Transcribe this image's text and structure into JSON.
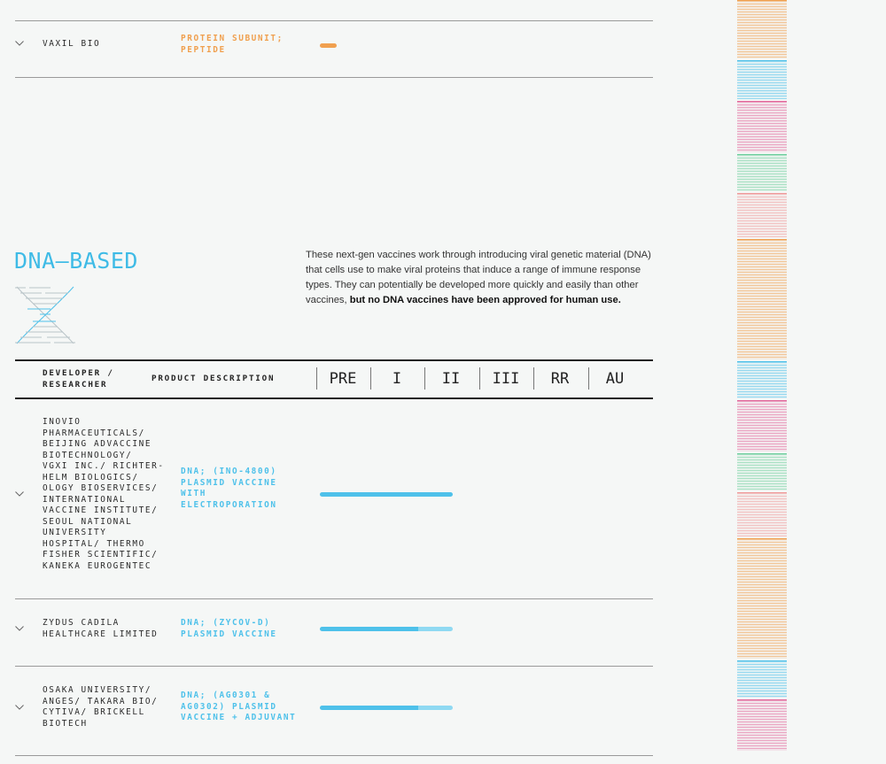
{
  "colors": {
    "orange": "#f0a04f",
    "blue": "#4ec1ea",
    "blue_light": "#8fd9f2",
    "pink": "#e2669a",
    "green": "#6fcf9f",
    "salmon": "#ef9a9a",
    "rule": "#9a9a9a"
  },
  "top_row": {
    "developer": "VAXIL BIO",
    "description": "PROTEIN SUBUNIT;\nPEPTIDE",
    "progress": 0.12
  },
  "section": {
    "title": "DNA–BASED",
    "intro_text": "These next-gen vaccines work through introducing viral genetic material (DNA) that cells use to make viral proteins that induce a range of immune response types. They can potentially be developed more quickly and easily than other vaccines, ",
    "intro_bold": "but no DNA vaccines have been approved for human use.",
    "icon": "dna-helix-icon"
  },
  "table_header": {
    "developer_label": "DEVELOPER /\nRESEARCHER",
    "product_label": "PRODUCT DESCRIPTION",
    "phases": [
      "PRE",
      "I",
      "II",
      "III",
      "RR",
      "AU"
    ]
  },
  "rows": [
    {
      "developer": "INOVIO\nPHARMACEUTICALS/\nBEIJING ADVACCINE\nBIOTECHNOLOGY/\nVGXI INC./ RICHTER-\nHELM BIOLOGICS/\nOLOGY BIOSERVICES/\nINTERNATIONAL\nVACCINE INSTITUTE/\nSEOUL NATIONAL\nUNIVERSITY\nHOSPITAL/ THERMO\nFISHER SCIENTIFIC/\nKANEKA EUROGENTEC",
      "description": "DNA; (INO-4800)\nPLASMID VACCINE\nWITH\nELECTROPORATION",
      "stage_solid": 0.5,
      "stage_light": 0.0
    },
    {
      "developer": "ZYDUS CADILA\nHEALTHCARE LIMITED",
      "description": "DNA; (ZYCOV-D)\nPLASMID VACCINE",
      "stage_solid": 0.37,
      "stage_light": 0.13
    },
    {
      "developer": "OSAKA UNIVERSITY/\nANGES/ TAKARA BIO/\nCYTIVA/ BRICKELL\nBIOTECH",
      "description": "DNA; (AG0301 &\nAG0302) PLASMID\nVACCINE + ADJUVANT",
      "stage_solid": 0.37,
      "stage_light": 0.13
    }
  ],
  "sidebar_blocks": [
    {
      "color": "orange"
    },
    {
      "color": "blue"
    },
    {
      "color": "pink"
    },
    {
      "color": "green"
    },
    {
      "color": "salmon"
    },
    {
      "color": "orange"
    },
    {
      "color": "blue"
    },
    {
      "color": "pink"
    },
    {
      "color": "green"
    },
    {
      "color": "salmon"
    },
    {
      "color": "orange"
    },
    {
      "color": "blue"
    },
    {
      "color": "pink"
    }
  ]
}
